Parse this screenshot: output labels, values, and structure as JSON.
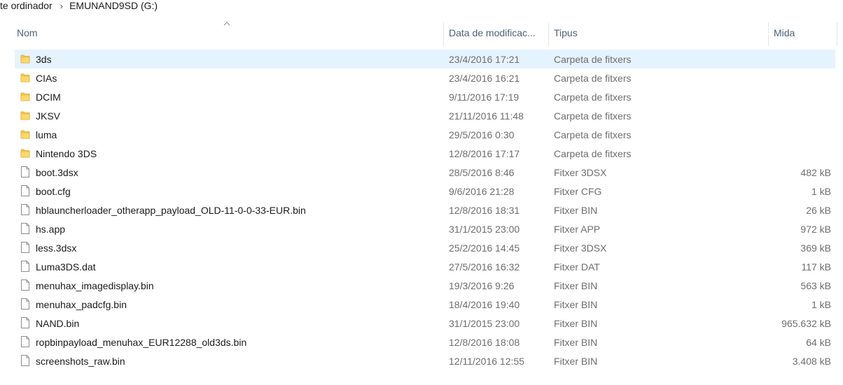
{
  "breadcrumb": {
    "items": [
      "te ordinador",
      "EMUNAND9SD (G:)"
    ]
  },
  "columns": {
    "name": "Nom",
    "date": "Data de modificac...",
    "type": "Tipus",
    "size": "Mida"
  },
  "files": [
    {
      "name": "3ds",
      "date": "23/4/2016 17:21",
      "type": "Carpeta de fitxers",
      "size": "",
      "kind": "folder",
      "selected": true
    },
    {
      "name": "CIAs",
      "date": "23/4/2016 16:21",
      "type": "Carpeta de fitxers",
      "size": "",
      "kind": "folder"
    },
    {
      "name": "DCIM",
      "date": "9/11/2016 17:19",
      "type": "Carpeta de fitxers",
      "size": "",
      "kind": "folder"
    },
    {
      "name": "JKSV",
      "date": "21/11/2016 11:48",
      "type": "Carpeta de fitxers",
      "size": "",
      "kind": "folder"
    },
    {
      "name": "luma",
      "date": "29/5/2016 0:30",
      "type": "Carpeta de fitxers",
      "size": "",
      "kind": "folder"
    },
    {
      "name": "Nintendo 3DS",
      "date": "12/8/2016 17:17",
      "type": "Carpeta de fitxers",
      "size": "",
      "kind": "folder"
    },
    {
      "name": "boot.3dsx",
      "date": "28/5/2016 8:46",
      "type": "Fitxer 3DSX",
      "size": "482 kB",
      "kind": "file"
    },
    {
      "name": "boot.cfg",
      "date": "9/6/2016 21:28",
      "type": "Fitxer CFG",
      "size": "1 kB",
      "kind": "file"
    },
    {
      "name": "hblauncherloader_otherapp_payload_OLD-11-0-0-33-EUR.bin",
      "date": "12/8/2016 18:31",
      "type": "Fitxer BIN",
      "size": "26 kB",
      "kind": "file"
    },
    {
      "name": "hs.app",
      "date": "31/1/2015 23:00",
      "type": "Fitxer APP",
      "size": "972 kB",
      "kind": "file"
    },
    {
      "name": "less.3dsx",
      "date": "25/2/2016 14:45",
      "type": "Fitxer 3DSX",
      "size": "369 kB",
      "kind": "file"
    },
    {
      "name": "Luma3DS.dat",
      "date": "27/5/2016 16:32",
      "type": "Fitxer DAT",
      "size": "117 kB",
      "kind": "file"
    },
    {
      "name": "menuhax_imagedisplay.bin",
      "date": "19/3/2016 9:26",
      "type": "Fitxer BIN",
      "size": "563 kB",
      "kind": "file"
    },
    {
      "name": "menuhax_padcfg.bin",
      "date": "18/4/2016 19:40",
      "type": "Fitxer BIN",
      "size": "1 kB",
      "kind": "file"
    },
    {
      "name": "NAND.bin",
      "date": "31/1/2015 23:00",
      "type": "Fitxer BIN",
      "size": "965.632 kB",
      "kind": "file"
    },
    {
      "name": "ropbinpayload_menuhax_EUR12288_old3ds.bin",
      "date": "12/8/2016 18:08",
      "type": "Fitxer BIN",
      "size": "64 kB",
      "kind": "file"
    },
    {
      "name": "screenshots_raw.bin",
      "date": "12/11/2016 12:55",
      "type": "Fitxer BIN",
      "size": "3.408 kB",
      "kind": "file"
    }
  ],
  "colors": {
    "folder": "#f6c94a",
    "selection": "#e5f3ff",
    "header_text": "#4c607a",
    "meta_text": "#6d6d6d"
  },
  "icons": {
    "folder": "folder-icon",
    "file": "file-icon",
    "sort": "sort-up-icon"
  }
}
